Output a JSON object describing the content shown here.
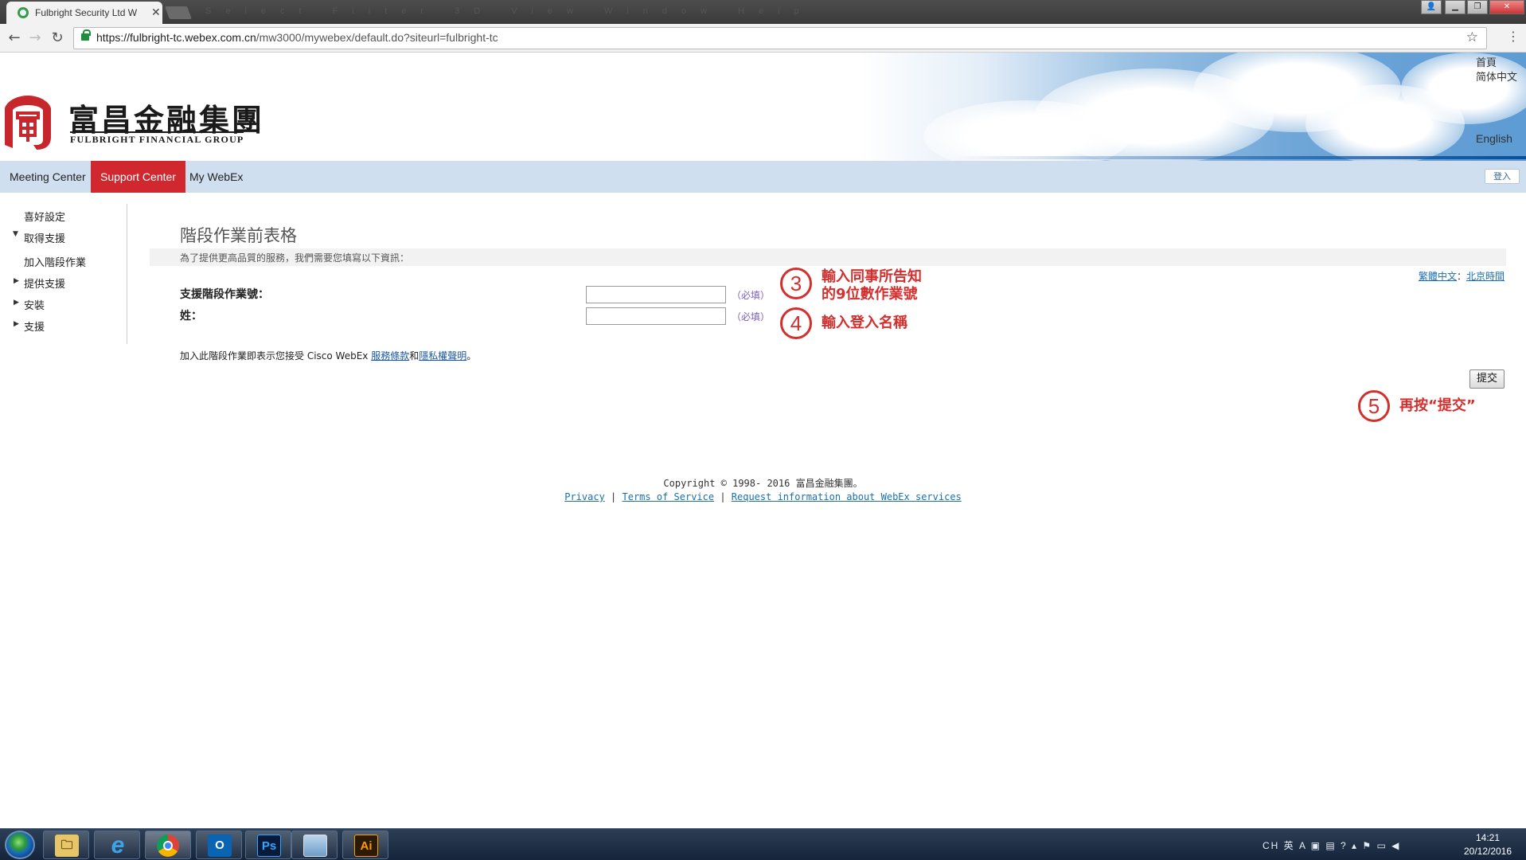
{
  "browser": {
    "tab_title": "Fulbright Security Ltd W",
    "ghost_menu": "Select Filter 3D View Window Help",
    "url_host": "https://fulbright-tc.webex.com.cn",
    "url_path": "/mw3000/mywebex/default.do?siteurl=fulbright-tc",
    "back_icon": "←",
    "forward_icon": "→",
    "reload_icon": "↻",
    "star_icon": "☆",
    "menu_icon": "⋮",
    "window_controls": [
      "▁",
      "❐",
      "✕"
    ]
  },
  "header": {
    "logo_cn": "富昌金融集團",
    "logo_en": "FULBRIGHT FINANCIAL GROUP",
    "home_link": "首頁",
    "simplified_link": "简体中文",
    "english_link": "English"
  },
  "nav": {
    "items": [
      "Meeting Center",
      "Support Center",
      "My WebEx"
    ],
    "active_index": 1,
    "login_button": "登入"
  },
  "sidebar": {
    "preferences": "喜好設定",
    "get_support": "取得支援",
    "join_session": "加入階段作業",
    "provide_support": "提供支援",
    "setup": "安裝",
    "support": "支援"
  },
  "form": {
    "title": "階段作業前表格",
    "info_text": "為了提供更高品質的服務，我們需要您填寫以下資訊：",
    "timezone_lang": "繁體中文",
    "timezone_sep": "：",
    "timezone_city": "北京時間",
    "session_label": "支援階段作業號：",
    "session_value": "",
    "name_label": "姓：",
    "name_value": "",
    "required_text": "（必填）",
    "terms_prefix": "加入此階段作業即表示您接受 Cisco WebEx ",
    "terms_link": "服務條款",
    "terms_and": "和",
    "privacy_link": "隱私權聲明",
    "terms_suffix": "。",
    "submit_button": "提交"
  },
  "annotations": {
    "step3_number": "3",
    "step3_line1": "輸入同事所告知",
    "step3_line2": "的9位數作業號",
    "step4_number": "4",
    "step4_text": "輸入登入名稱",
    "step5_number": "5",
    "step5_text": "再按“提交”",
    "color": "#d32f2f"
  },
  "footer": {
    "copyright": "Copyright © 1998- 2016 富昌金融集團。",
    "privacy": "Privacy",
    "sep": " | ",
    "terms": "Terms of Service",
    "request": "Request information about WebEx services"
  },
  "taskbar": {
    "apps": [
      {
        "name": "explorer-icon",
        "label": "🗀"
      },
      {
        "name": "internet-explorer-icon",
        "label": "e"
      },
      {
        "name": "chrome-icon",
        "label": ""
      },
      {
        "name": "outlook-icon",
        "label": "O"
      },
      {
        "name": "photoshop-icon",
        "label": "Ps"
      },
      {
        "name": "window-app-icon",
        "label": ""
      },
      {
        "name": "illustrator-icon",
        "label": "Ai"
      }
    ],
    "tray_text": "CH 英 A ▣ ▤ ? ▴ ⚑ ▭ ◀",
    "time": "14:21",
    "date": "20/12/2016"
  }
}
